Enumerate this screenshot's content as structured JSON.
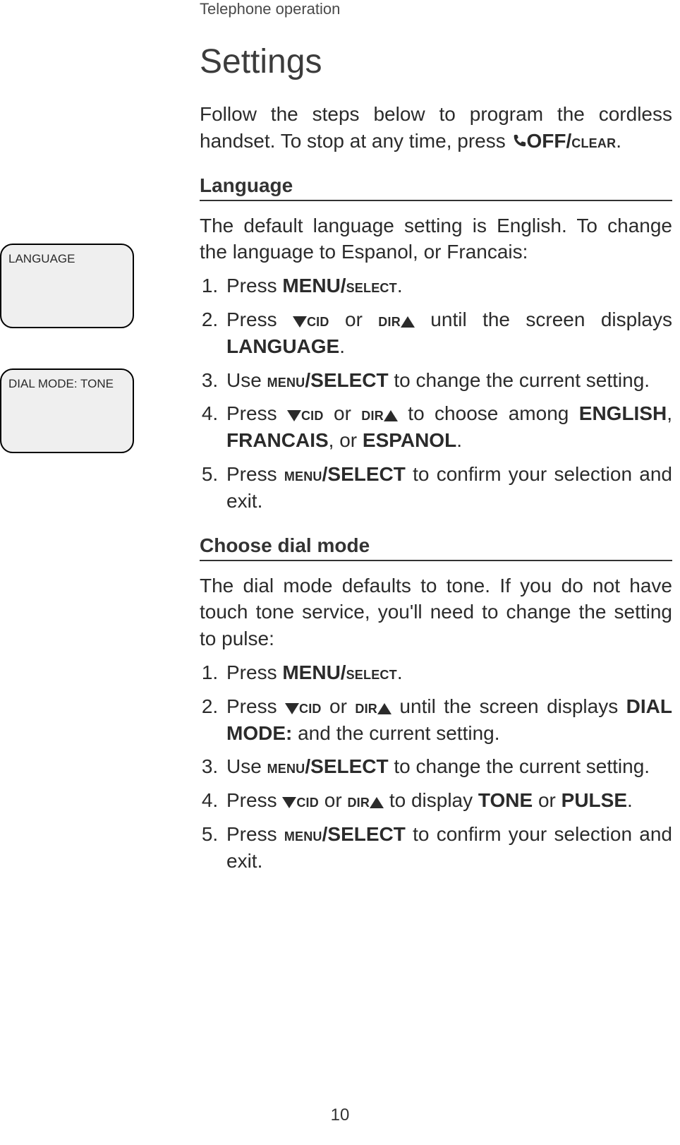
{
  "header": {
    "running": "Telephone operation"
  },
  "page_number": "10",
  "title": "Settings",
  "intro": {
    "a": "Follow the steps below to program the cordless handset. To stop at any time, press ",
    "off": "OFF/",
    "clear": "CLEAR",
    "dot": "."
  },
  "lang": {
    "heading": "Language",
    "intro": "The default language setting is English. To change the language to Espanol, or Francais:",
    "s1a": "Press ",
    "s1b": "MENU/",
    "s1c": "SELECT",
    "s1d": ".",
    "s2a": "Press ",
    "s2cid": "CID",
    "s2b": " or ",
    "s2dir": "DIR",
    "s2c": " until the screen displays ",
    "s2d": "LANGUAGE",
    "s2e": ".",
    "s3a": "Use ",
    "s3b": "MENU",
    "s3c": "/SELECT",
    "s3d": " to change the current setting.",
    "s4a": "Press ",
    "s4cid": "CID",
    "s4b": " or ",
    "s4dir": "DIR",
    "s4c": " to choose among ",
    "s4d": "ENGLISH",
    "s4e": ", ",
    "s4f": "FRANCAIS",
    "s4g": ", or ",
    "s4h": "ESPANOL",
    "s4i": ".",
    "s5a": "Press ",
    "s5b": "MENU",
    "s5c": "/SELECT",
    "s5d": " to confirm your selection and exit."
  },
  "dial": {
    "heading": "Choose dial mode",
    "intro": "The dial mode defaults to tone. If you do not have touch tone service, you'll need to change the set­ting to pulse:",
    "s1a": "Press ",
    "s1b": "MENU/",
    "s1c": "SELECT",
    "s1d": ".",
    "s2a": "Press ",
    "s2cid": "CID",
    "s2b": " or ",
    "s2dir": "DIR",
    "s2c": " until the screen displays ",
    "s2d": "DIAL MODE:",
    "s2e": " and the current setting.",
    "s3a": "Use ",
    "s3b": "MENU",
    "s3c": "/SELECT",
    "s3d": " to change the current setting.",
    "s4a": "Press ",
    "s4cid": "CID",
    "s4b": " or ",
    "s4dir": "DIR",
    "s4c": " to display ",
    "s4d": "TONE",
    "s4e": " or ",
    "s4f": "PULSE",
    "s4g": ".",
    "s5a": "Press ",
    "s5b": "MENU",
    "s5c": "/SELECT",
    "s5d": " to confirm your selection and exit."
  },
  "lcds": {
    "lang": "LANGUAGE",
    "dial": "DIAL MODE: TONE"
  }
}
